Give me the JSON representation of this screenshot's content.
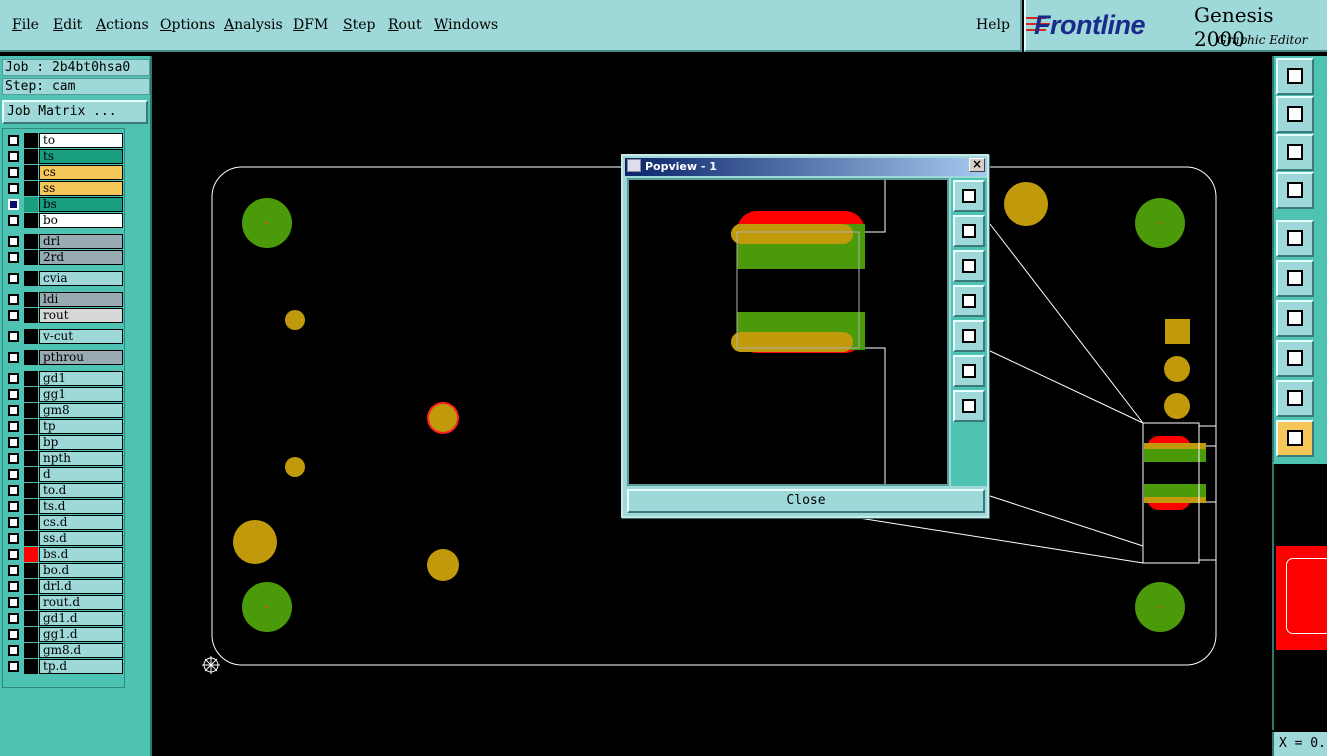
{
  "menu": {
    "items": [
      {
        "mnemonic": "F",
        "rest": "ile"
      },
      {
        "mnemonic": "E",
        "rest": "dit"
      },
      {
        "mnemonic": "A",
        "rest": "ctions"
      },
      {
        "mnemonic": "O",
        "rest": "ptions"
      },
      {
        "mnemonic": "A",
        "rest": "nalysis"
      },
      {
        "mnemonic": "D",
        "rest": "FM"
      },
      {
        "mnemonic": "S",
        "rest": "tep"
      },
      {
        "mnemonic": "R",
        "rest": "out"
      },
      {
        "mnemonic": "W",
        "rest": "indows"
      }
    ],
    "help": "Help"
  },
  "brand": {
    "logo": "Frontline",
    "title": "Genesis 2000",
    "subtitle": "Graphic Editor"
  },
  "job": {
    "job_label": "Job : 2b4bt0hsa0",
    "step_label": "Step: cam",
    "matrix_button": "Job Matrix ..."
  },
  "layers": [
    {
      "name": "to",
      "color": "#ffffff",
      "swatch": "#000000",
      "active": false
    },
    {
      "name": "ts",
      "color": "#1a9e80",
      "swatch": "#000000",
      "active": false
    },
    {
      "name": "cs",
      "color": "#f5c65a",
      "swatch": "#000000",
      "active": false
    },
    {
      "name": "ss",
      "color": "#f5c65a",
      "swatch": "#000000",
      "active": false
    },
    {
      "name": "bs",
      "color": "#1a9e80",
      "swatch": "#1a9e80",
      "active": true
    },
    {
      "name": "bo",
      "color": "#ffffff",
      "swatch": "#000000",
      "active": false
    },
    {
      "name": "drl",
      "color": "#98aab2",
      "swatch": "#000000",
      "active": false
    },
    {
      "name": "2rd",
      "color": "#98aab2",
      "swatch": "#000000",
      "active": false
    },
    {
      "name": "cvia",
      "color": "#9ed8d8",
      "swatch": "#000000",
      "active": false
    },
    {
      "name": "ldi",
      "color": "#98aab2",
      "swatch": "#000000",
      "active": false
    },
    {
      "name": "rout",
      "color": "#d8d8d8",
      "swatch": "#000000",
      "active": false
    },
    {
      "name": "v-cut",
      "color": "#9ed8d8",
      "swatch": "#000000",
      "active": false
    },
    {
      "name": "pthrou",
      "color": "#98aab2",
      "swatch": "#000000",
      "active": false
    },
    {
      "name": "gd1",
      "color": "#9ed8d8",
      "swatch": "#000000",
      "active": false
    },
    {
      "name": "gg1",
      "color": "#9ed8d8",
      "swatch": "#000000",
      "active": false
    },
    {
      "name": "gm8",
      "color": "#9ed8d8",
      "swatch": "#000000",
      "active": false
    },
    {
      "name": "tp",
      "color": "#9ed8d8",
      "swatch": "#000000",
      "active": false
    },
    {
      "name": "bp",
      "color": "#9ed8d8",
      "swatch": "#000000",
      "active": false
    },
    {
      "name": "npth",
      "color": "#9ed8d8",
      "swatch": "#000000",
      "active": false
    },
    {
      "name": "d",
      "color": "#9ed8d8",
      "swatch": "#000000",
      "active": false
    },
    {
      "name": "to.d",
      "color": "#9ed8d8",
      "swatch": "#000000",
      "active": false
    },
    {
      "name": "ts.d",
      "color": "#9ed8d8",
      "swatch": "#000000",
      "active": false
    },
    {
      "name": "cs.d",
      "color": "#9ed8d8",
      "swatch": "#000000",
      "active": false
    },
    {
      "name": "ss.d",
      "color": "#9ed8d8",
      "swatch": "#000000",
      "active": false
    },
    {
      "name": "bs.d",
      "color": "#9ed8d8",
      "swatch": "#ff0000",
      "active": false
    },
    {
      "name": "bo.d",
      "color": "#9ed8d8",
      "swatch": "#000000",
      "active": false
    },
    {
      "name": "drl.d",
      "color": "#9ed8d8",
      "swatch": "#000000",
      "active": false
    },
    {
      "name": "rout.d",
      "color": "#9ed8d8",
      "swatch": "#000000",
      "active": false
    },
    {
      "name": "gd1.d",
      "color": "#9ed8d8",
      "swatch": "#000000",
      "active": false
    },
    {
      "name": "gg1.d",
      "color": "#9ed8d8",
      "swatch": "#000000",
      "active": false
    },
    {
      "name": "gm8.d",
      "color": "#9ed8d8",
      "swatch": "#000000",
      "active": false
    },
    {
      "name": "tp.d",
      "color": "#9ed8d8",
      "swatch": "#000000",
      "active": false
    }
  ],
  "popview": {
    "title": "Popview - 1",
    "close_label": "Close",
    "tool_icons": [
      "zoom-window-icon",
      "pan-up-icon",
      "pan-down-icon",
      "pan-left-icon",
      "pan-right-icon",
      "zoom-fit-icon",
      "zoom-home-icon"
    ]
  },
  "right_tools": {
    "icons": [
      "pan-up-icon",
      "pan-left-icon",
      "zoom-fit-icon",
      "settings-icon",
      "display-icon",
      "net-icon",
      "measure-icon",
      "snap-icon",
      "triangle-icon",
      "select-arrow-icon"
    ]
  },
  "status": {
    "coord": "X = 0."
  },
  "colors": {
    "panel": "#9ed8d8",
    "panel_dark": "#4fc3b3",
    "pad_gold": "#c19a0b",
    "pad_green": "#4b9a0a",
    "pad_red": "#ff0000",
    "outline": "#ffffff"
  }
}
